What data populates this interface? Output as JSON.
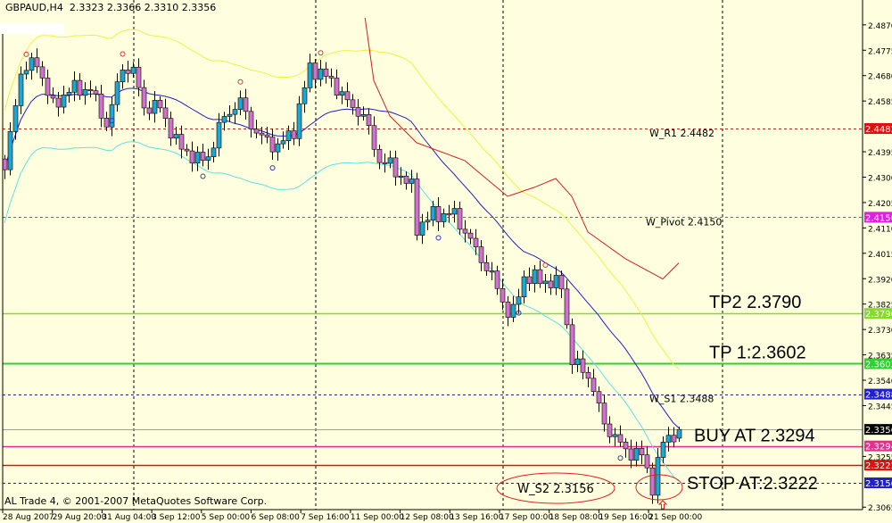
{
  "header": {
    "symbol": "GBPAUD,H4",
    "ohlc": "2.3323 2.3366 2.3310 2.3356"
  },
  "footer": {
    "copyright": "AL Trade 4, © 2001-2007 MetaQuotes Software Corp."
  },
  "colors": {
    "background": "#ffffe0",
    "bull": "#1aa8d8",
    "bear": "#d070d0",
    "ma": "#2020c0",
    "upper_band": "#f0f040",
    "lower_band": "#60e0e8",
    "envelope_red": "#d02020"
  },
  "chart_data": {
    "type": "candlestick",
    "symbol": "GBPAUD",
    "timeframe": "H4",
    "ylim": [
      2.305,
      2.492
    ],
    "y_ticks": [
      2.487,
      2.4775,
      2.468,
      2.4585,
      2.4395,
      2.43,
      2.4205,
      2.411,
      2.4015,
      2.392,
      2.3825,
      2.373,
      2.3635,
      2.354,
      2.3445,
      2.3255,
      2.3065
    ],
    "x_tick_labels": [
      "28 Aug 2007",
      "29 Aug 20:00",
      "31 Aug 04:00",
      "3 Sep 12:00",
      "5 Sep 00:00",
      "6 Sep 08:00",
      "7 Sep 16:00",
      "11 Sep 00:00",
      "12 Sep 08:00",
      "13 Sep 16:00",
      "17 Sep 00:00",
      "18 Sep 08:00",
      "19 Sep 16:00",
      "21 Sep 00:00"
    ],
    "bar_count": 127,
    "close_keyframes": [
      [
        0,
        2.4328
      ],
      [
        3,
        2.4696
      ],
      [
        6,
        2.4729
      ],
      [
        9,
        2.4562
      ],
      [
        12,
        2.4629
      ],
      [
        16,
        2.4629
      ],
      [
        19,
        2.4495
      ],
      [
        22,
        2.4712
      ],
      [
        24,
        2.4696
      ],
      [
        26,
        2.4562
      ],
      [
        29,
        2.4562
      ],
      [
        32,
        2.4429
      ],
      [
        36,
        2.4362
      ],
      [
        38,
        2.4378
      ],
      [
        41,
        2.4529
      ],
      [
        44,
        2.4579
      ],
      [
        47,
        2.4462
      ],
      [
        51,
        2.4412
      ],
      [
        54,
        2.4479
      ],
      [
        57,
        2.4712
      ],
      [
        61,
        2.4662
      ],
      [
        64,
        2.4579
      ],
      [
        67,
        2.4529
      ],
      [
        70,
        2.4362
      ],
      [
        72,
        2.4345
      ],
      [
        76,
        2.4262
      ],
      [
        77,
        2.4111
      ],
      [
        80,
        2.4161
      ],
      [
        84,
        2.4161
      ],
      [
        87,
        2.4061
      ],
      [
        91,
        2.3928
      ],
      [
        94,
        2.3794
      ],
      [
        95,
        2.3794
      ],
      [
        97,
        2.3928
      ],
      [
        101,
        2.3911
      ],
      [
        104,
        2.3894
      ],
      [
        106,
        2.361
      ],
      [
        109,
        2.356
      ],
      [
        112,
        2.3376
      ],
      [
        116,
        2.3276
      ],
      [
        119,
        2.326
      ],
      [
        121,
        2.3143
      ],
      [
        123,
        2.331
      ],
      [
        126,
        2.3356
      ]
    ],
    "last_bar": {
      "open": 2.3323,
      "high": 2.3366,
      "low": 2.331,
      "close": 2.3356
    },
    "red_line_keyframes": [
      [
        67,
        2.495
      ],
      [
        69,
        2.4662
      ],
      [
        72,
        2.4529
      ],
      [
        77,
        2.4429
      ],
      [
        86,
        2.4362
      ],
      [
        94,
        2.4228
      ],
      [
        99,
        2.4262
      ],
      [
        103,
        2.4295
      ],
      [
        106,
        2.4228
      ],
      [
        109,
        2.4095
      ],
      [
        116,
        2.3995
      ],
      [
        123,
        2.3919
      ],
      [
        126,
        2.3979
      ]
    ],
    "fractals": [
      [
        4,
        "up"
      ],
      [
        22,
        "up"
      ],
      [
        44,
        "up"
      ],
      [
        59,
        "up"
      ],
      [
        101,
        "up"
      ],
      [
        20,
        "down"
      ],
      [
        37,
        "down"
      ],
      [
        50,
        "down"
      ],
      [
        81,
        "down"
      ],
      [
        96,
        "down"
      ],
      [
        115,
        "down"
      ]
    ],
    "vertical_grid_bars": [
      24,
      58,
      93,
      134
    ],
    "levels": [
      {
        "name": "W_R1",
        "price": 2.4482,
        "label": "W_R1 2.4482",
        "axis_label": "2.4482",
        "color": "#e01010",
        "style": "dashed",
        "big": false
      },
      {
        "name": "W_Pivot",
        "price": 2.415,
        "label": "W_Pivot 2.4150",
        "axis_label": "2.4150",
        "color": "#e020e0",
        "style": "dashed",
        "big": false
      },
      {
        "name": "TP2",
        "price": 2.379,
        "label": "TP2  2.3790",
        "axis_label": "2.3790",
        "color": "#80e020",
        "style": "solid",
        "big": true
      },
      {
        "name": "TP1",
        "price": 2.3602,
        "label": "TP 1:2.3602",
        "axis_label": "2.3602",
        "color": "#30d030",
        "style": "solid",
        "big": true
      },
      {
        "name": "W_S1",
        "price": 2.3488,
        "label": "W_S1 2.3488",
        "axis_label": "2.3488",
        "color": "#2020d0",
        "style": "dashed",
        "big": false
      },
      {
        "name": "Current",
        "price": 2.3356,
        "label": "",
        "axis_label": "2.3356",
        "color": "#a0a0a0",
        "style": "solid",
        "big": false,
        "badge": "#000000"
      },
      {
        "name": "BUY",
        "price": 2.3294,
        "label": "BUY AT 2.3294",
        "axis_label": "2.3294",
        "color": "#e03090",
        "style": "solid",
        "big": true
      },
      {
        "name": "STOP",
        "price": 2.3222,
        "label": "STOP AT:2.3222",
        "axis_label": "2.3222",
        "color": "#e01010",
        "style": "solid",
        "big": true
      },
      {
        "name": "W_S2",
        "price": 2.3156,
        "label": "W_S2 2.3156",
        "axis_label": "2.3156",
        "color": "#2020d0",
        "style": "dashed",
        "big": false
      }
    ]
  }
}
